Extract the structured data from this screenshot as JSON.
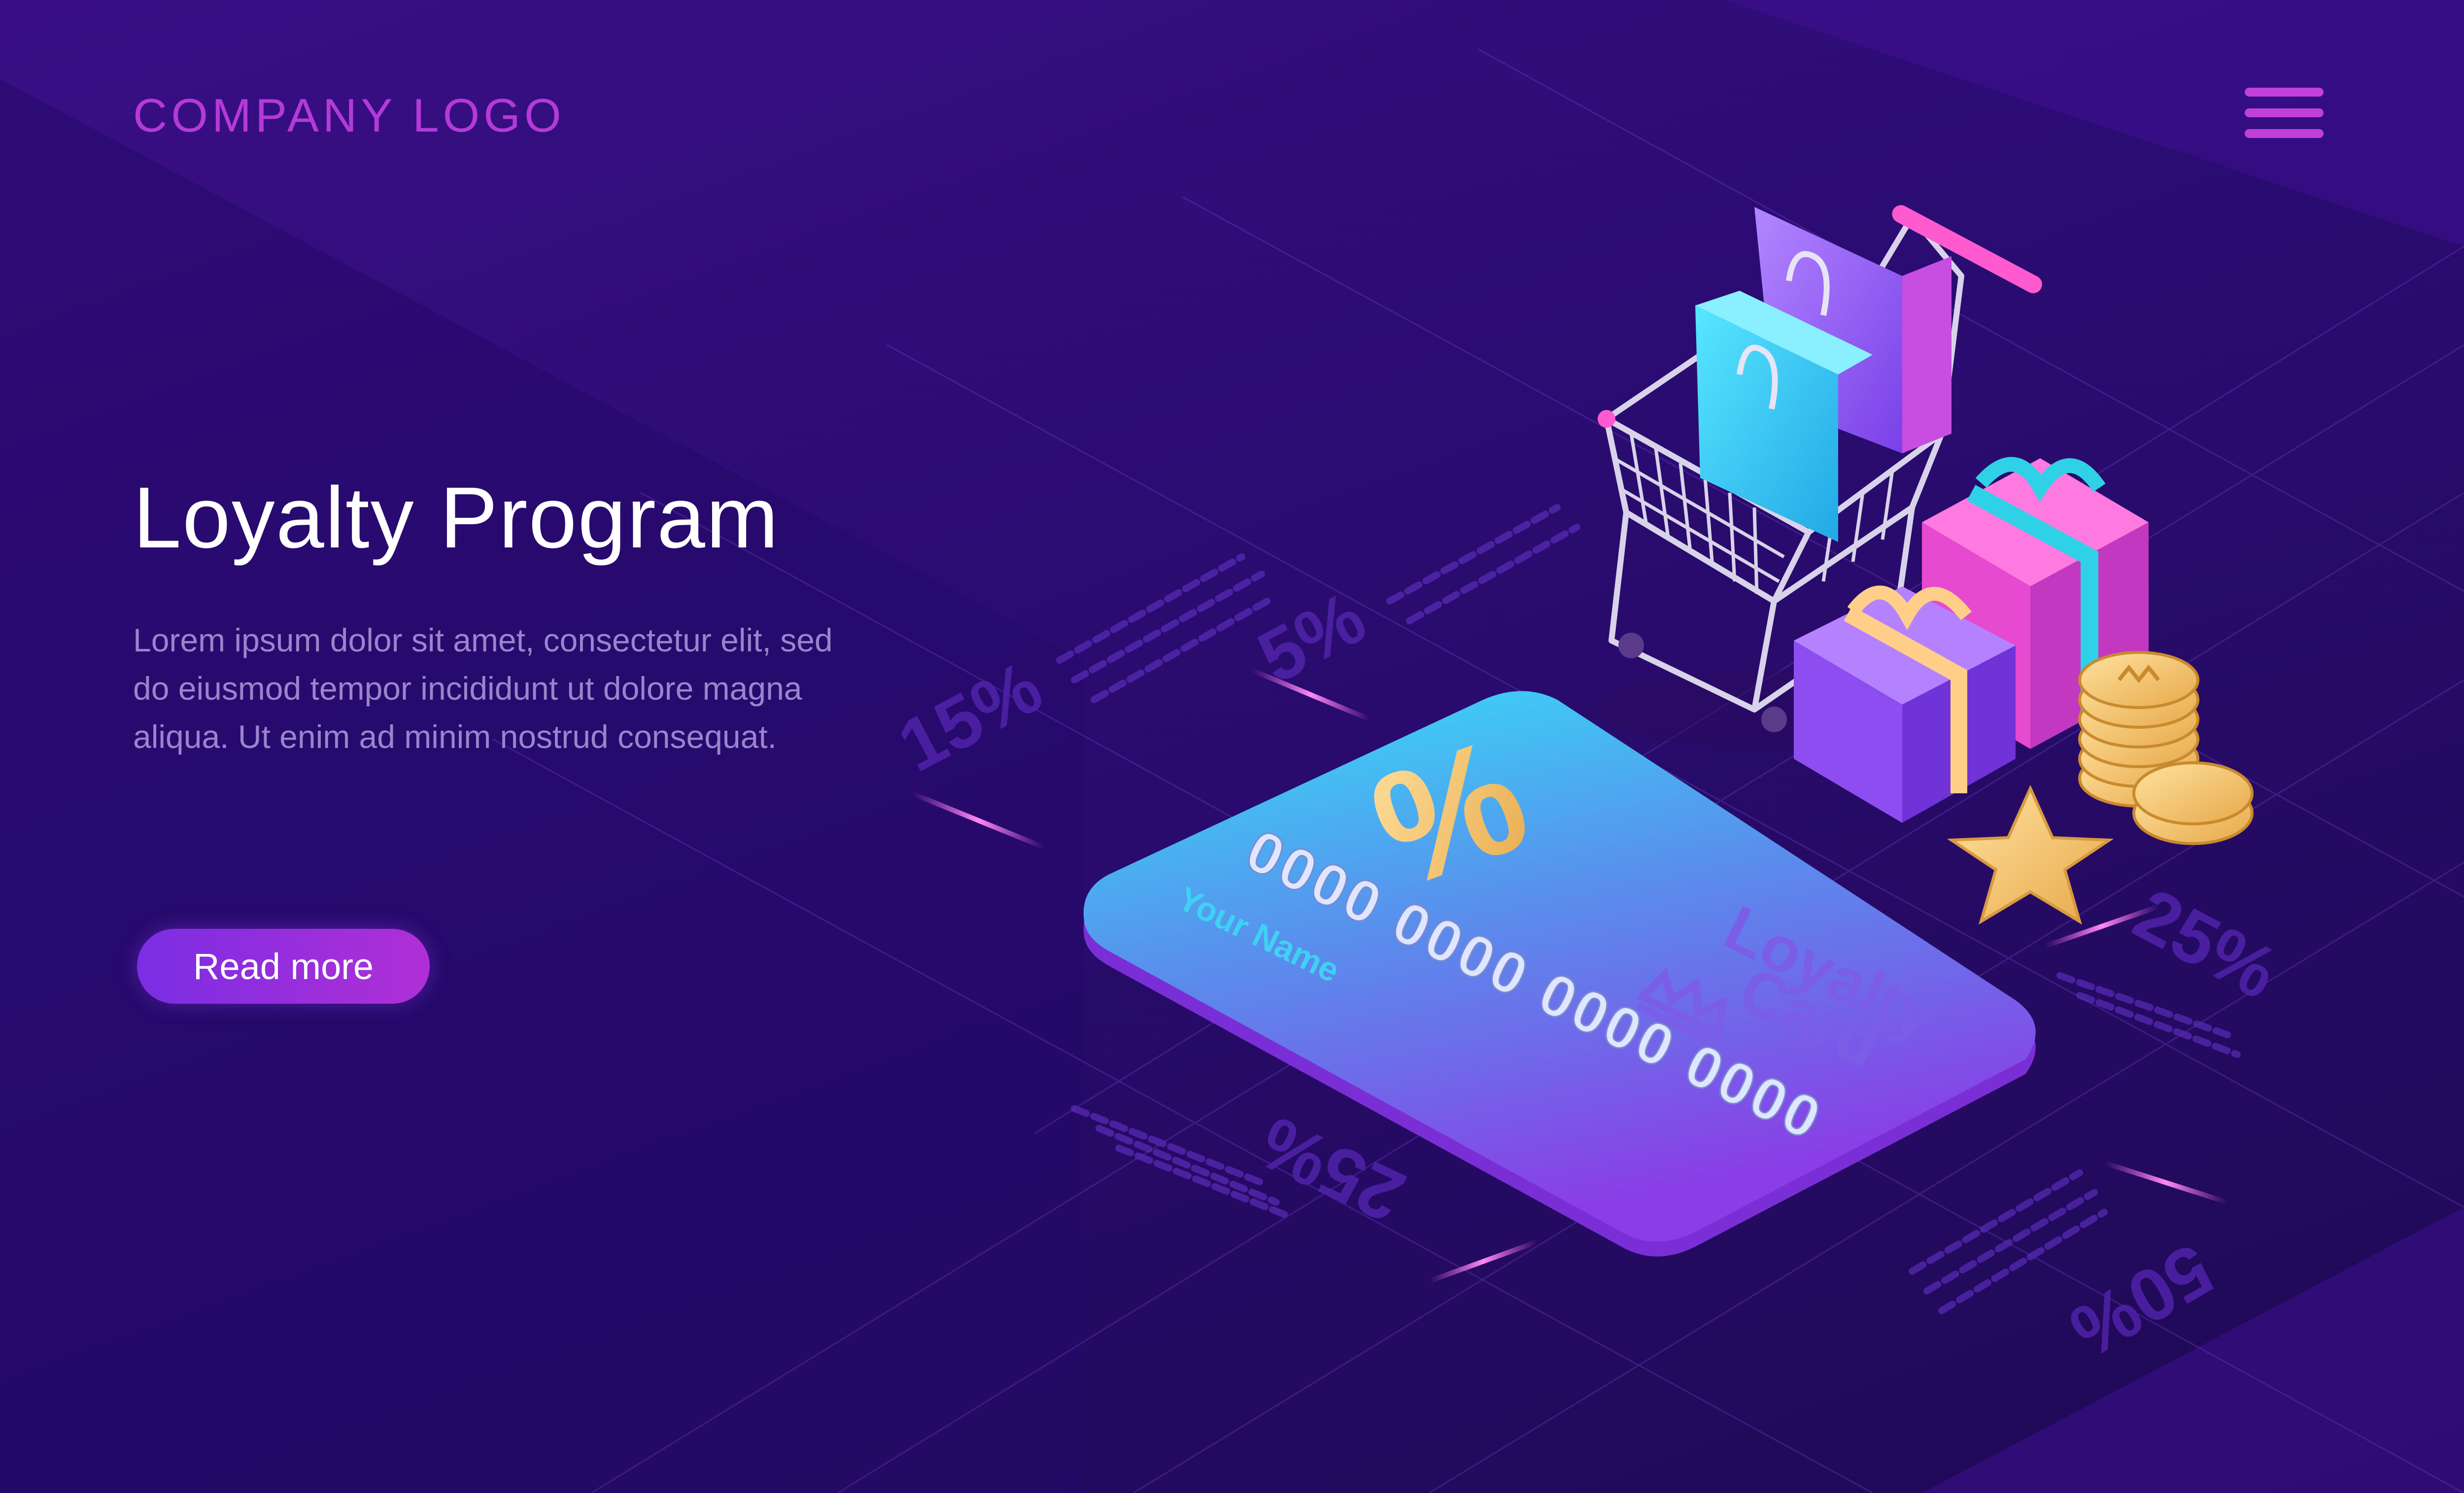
{
  "header": {
    "logo_text": "COMPANY LOGO",
    "menu_icon": "hamburger-menu-icon"
  },
  "hero": {
    "title": "Loyalty Program",
    "description": "Lorem ipsum dolor sit amet, consectetur elit, sed do eiusmod tempor incididunt ut dolore magna aliqua. Ut enim ad minim nostrud consequat.",
    "button_label": "Read more"
  },
  "card": {
    "percent_symbol": "%",
    "number": "0000 0000 0000 0000",
    "holder": "Your Name",
    "brand_line1": "Loyalty",
    "brand_line2": "Card",
    "icons": [
      "crown-icon"
    ]
  },
  "floor_labels": {
    "fifteen": "15%",
    "five": "5%",
    "twentyfive_right": "25%",
    "twentyfive_bottom": "25%",
    "fifty_bottom": "50%"
  },
  "illustration_icons": [
    "shopping-cart-icon",
    "shopping-bag-icon",
    "gift-box-icon",
    "coin-icon",
    "star-icon"
  ],
  "colors": {
    "background": "#2b0c73",
    "logo": "#b43ad8",
    "title": "#ffffff",
    "description": "#9a84cc",
    "button_start": "#7a2ee3",
    "button_end": "#b02fd6",
    "card_top": "#35d6f5",
    "card_bottom": "#8a3ee6",
    "gold": "#f4c06a"
  }
}
